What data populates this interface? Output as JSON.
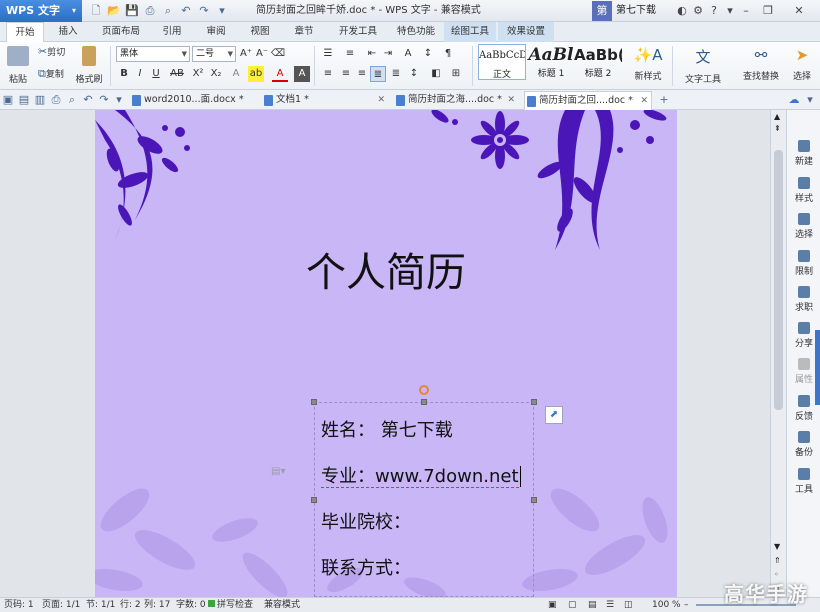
{
  "app": {
    "name": "WPS 文字",
    "doc_title": "简历封面之回眸千娇.doc * - WPS 文字 - 兼容模式",
    "user": "第七下载",
    "user_badge": "第",
    "accent": "#2b6fc6"
  },
  "tabs": [
    "开始",
    "插入",
    "页面布局",
    "引用",
    "审阅",
    "视图",
    "章节",
    "开发工具",
    "特色功能",
    "绘图工具",
    "效果设置"
  ],
  "ribbon": {
    "paste": "粘贴",
    "cut": "剪切",
    "copy": "复制",
    "format_painter": "格式刷",
    "font_name": "黑体",
    "font_size": "二号",
    "styles": [
      {
        "sample": "AaBbCcD",
        "name": "正文"
      },
      {
        "sample": "AaBl",
        "name": "标题 1"
      },
      {
        "sample": "AaBb(",
        "name": "标题 2"
      }
    ],
    "new_style": "新样式",
    "text_tools": "文字工具",
    "find_replace": "查找替换",
    "select": "选择"
  },
  "doc_tabs": [
    {
      "label": "word2010...面.docx *"
    },
    {
      "label": "文档1 *"
    },
    {
      "label": "简历封面之海....doc *"
    },
    {
      "label": "简历封面之回....doc *"
    }
  ],
  "page": {
    "title": "个人简历",
    "fields": [
      "姓名：  第七下载",
      "专业：www.7down.net",
      "毕业院校：",
      "联系方式："
    ],
    "bg_color": "#c8b6f7",
    "ornament_color": "#4b16b8"
  },
  "right_panel": [
    "新建",
    "样式",
    "选择",
    "限制",
    "求职",
    "分享",
    "属性",
    "反馈",
    "备份",
    "工具"
  ],
  "status": {
    "page_code": "页码: 1",
    "pages": "页面: 1/1",
    "section": "节: 1/1",
    "row": "行: 2",
    "col": "列: 17",
    "words": "字数: 0",
    "spell": "拼写检查",
    "compat": "兼容模式",
    "zoom": "100 %"
  },
  "watermark": "高华手游"
}
